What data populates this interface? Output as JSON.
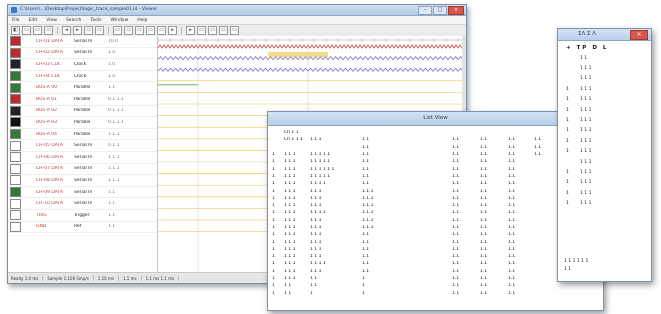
{
  "main": {
    "title": "C:\\Users\\...\\Desktop\\Project\\logic_trace_sample01.ld - Viewer",
    "window_buttons": [
      "–",
      "□",
      "×"
    ],
    "menu": [
      "File",
      "Edit",
      "View",
      "Search",
      "Tools",
      "Window",
      "Help"
    ],
    "toolbar": [
      "◧",
      "▭",
      "▭",
      "▭",
      "◂",
      "▸",
      "▭",
      "▭",
      "▭",
      "▭",
      "▭",
      "▭",
      "▭",
      "▸",
      "▸",
      "▭",
      "▭",
      "▭",
      "▭"
    ],
    "signals": [
      {
        "num": "",
        "name": "CH-01 DATA",
        "type": "Serial In",
        "val": "10.0",
        "color": "#c62828"
      },
      {
        "num": "",
        "name": "CH-02 DATA",
        "type": "Serial In",
        "val": "1.0",
        "color": "#c62828"
      },
      {
        "num": "",
        "name": "CH-03 CLK",
        "type": "Clock",
        "val": "1.0",
        "color": "#222222"
      },
      {
        "num": "",
        "name": "CH-04 CLK",
        "type": "Clock",
        "val": "1.0",
        "color": "#2e7d32"
      },
      {
        "num": "",
        "name": "BUS-A 00",
        "type": "Parallel",
        "val": "1.1",
        "color": "#2e7d32"
      },
      {
        "num": "",
        "name": "BUS-A 01",
        "type": "Parallel",
        "val": "0.1.1.1",
        "color": "#c62828"
      },
      {
        "num": "",
        "name": "BUS-A 02",
        "type": "Parallel",
        "val": "0.1.1.1",
        "color": "#222222"
      },
      {
        "num": "",
        "name": "BUS-A 03",
        "type": "Parallel",
        "val": "0.1.1.1",
        "color": "#111111"
      },
      {
        "num": "",
        "name": "BUS-A 04",
        "type": "Parallel",
        "val": "1.1.1",
        "color": "#2e7d32"
      },
      {
        "num": "",
        "name": "CH-05 DATA",
        "type": "Serial In",
        "val": "0.1.1",
        "color": "#ffffff"
      },
      {
        "num": "",
        "name": "CH-06 DATA",
        "type": "Serial In",
        "val": "1.1.1",
        "color": "#ffffff"
      },
      {
        "num": "",
        "name": "CH-07 DATA",
        "type": "Serial In",
        "val": "1.1.1",
        "color": "#ffffff"
      },
      {
        "num": "",
        "name": "CH-08 DATA",
        "type": "Serial In",
        "val": "1.1.1",
        "color": "#ffffff"
      },
      {
        "num": "",
        "name": "CH-09 DATA",
        "type": "Serial In",
        "val": "1.1",
        "color": "#2e7d32"
      },
      {
        "num": "",
        "name": "CH-10 DATA",
        "type": "Serial In",
        "val": "1.1",
        "color": "#ffffff"
      },
      {
        "num": "",
        "name": "TRIG",
        "type": "Trigger",
        "val": "1.1",
        "color": "#ffffff"
      },
      {
        "num": "",
        "name": "GND",
        "type": "Ref",
        "val": "1.1",
        "color": "#ffffff"
      }
    ],
    "status": [
      "Ready 1.0 ms",
      "Sample 1:100 Smp/s",
      "1.10 ms",
      "1.1 ms",
      "1.1 ms 1.1 ms"
    ]
  },
  "list": {
    "title": "List View",
    "rows": [
      [
        "",
        "Ch 1 1",
        "",
        "",
        "",
        "",
        "",
        "",
        ""
      ],
      [
        "",
        "Ch 1 1 1",
        "1 1 1",
        "1 1",
        "",
        "1.1",
        "1.1",
        "1.1",
        "1.1"
      ],
      [
        "",
        "",
        "",
        "1.1",
        "",
        "1.1",
        "1.1",
        "1.1",
        "1.1"
      ],
      [
        "1",
        "1 1 1",
        "1 1 1 1 1",
        "1.1",
        "",
        "1.1",
        "1.1",
        "1.1",
        "1.1"
      ],
      [
        "1",
        "1 1 1",
        "1 1 1 1 1",
        "1.1",
        "",
        "1.1",
        "1.1",
        "1.1",
        ""
      ],
      [
        "1",
        "1 1 1",
        "1 1 1 1 1 1",
        "1.1",
        "",
        "1.1",
        "1.1",
        "1.1",
        ""
      ],
      [
        "1",
        "1 1 1",
        "1 1 1 1 1",
        "1.1",
        "",
        "1.1",
        "1.1",
        "1.1",
        ""
      ],
      [
        "1",
        "1 1 1",
        "1 1 1 1",
        "1.1",
        "",
        "1.1",
        "1.1",
        "1.1",
        ""
      ],
      [
        "1",
        "1 1 1",
        "1 1 1",
        "1.1.1",
        "",
        "1.1",
        "1.1",
        "1.1",
        ""
      ],
      [
        "1",
        "1 1 1",
        "1 1 1",
        "1.1.1",
        "",
        "1.1",
        "1.1",
        "1.1",
        ""
      ],
      [
        "1",
        "1 1 1",
        "1 1 1",
        "1.1.1",
        "",
        "1.1",
        "1.1",
        "1.1",
        ""
      ],
      [
        "1",
        "1 1 1",
        "1 1 1 1",
        "1.1.1",
        "",
        "1.1",
        "1.1",
        "1.1",
        ""
      ],
      [
        "1",
        "1 1 1",
        "1 1 1",
        "1.1.1",
        "",
        "1.1",
        "1.1",
        "1.1",
        ""
      ],
      [
        "1",
        "1 1 1",
        "1 1 1",
        "1.1.1",
        "",
        "1.1",
        "1.1",
        "1.1",
        ""
      ],
      [
        "1",
        "1 1 1",
        "1 1 1",
        "1.1",
        "",
        "1.1",
        "1.1",
        "1.1",
        ""
      ],
      [
        "1",
        "1 1 1",
        "1 1 1",
        "1.1",
        "",
        "1.1",
        "1.1",
        "1.1",
        ""
      ],
      [
        "1",
        "1 1 1",
        "1 1 1",
        "1.1",
        "",
        "1.1",
        "1.1",
        "1.1",
        ""
      ],
      [
        "1",
        "1 1 1",
        "1 1 1",
        "1.1",
        "",
        "1.1",
        "1.1",
        "1.1",
        ""
      ],
      [
        "1",
        "1 1 1",
        "1 1 1 1",
        "1.1",
        "",
        "1.1",
        "1.1",
        "1.1",
        ""
      ],
      [
        "1",
        "1 1 1",
        "1 1 1",
        "1.1",
        "",
        "1.1",
        "1.1",
        "1.1",
        ""
      ],
      [
        "1",
        "1 1 1",
        "1 1",
        "1",
        "",
        "1.1",
        "1.1",
        "1.1",
        ""
      ],
      [
        "1",
        "1 1",
        "1 1",
        "1",
        "",
        "1.1",
        "1.1",
        "1.1",
        ""
      ],
      [
        "1",
        "1 1",
        "1",
        "1",
        "",
        "1.1",
        "1.1",
        "1.1",
        ""
      ]
    ]
  },
  "side": {
    "title": "ΣΛ Σ Λ",
    "close": "×",
    "header": [
      "+",
      "T P",
      "D",
      "L"
    ],
    "rows": [
      {
        "k": "",
        "v": "1 1"
      },
      {
        "k": "",
        "v": "1 1 1"
      },
      {
        "k": "",
        "v": "1 1 1"
      },
      {
        "k": "1",
        "v": "1 1 1"
      },
      {
        "k": "1",
        "v": "1 1 1"
      },
      {
        "k": "1",
        "v": "1 1 1"
      },
      {
        "k": "1",
        "v": "1 1 1"
      },
      {
        "k": "1",
        "v": "1 1 1"
      },
      {
        "k": "1",
        "v": "1 1 1"
      },
      {
        "k": "1",
        "v": "1 1 1"
      },
      {
        "k": "",
        "v": "1 1 1"
      },
      {
        "k": "1",
        "v": "1 1 1"
      },
      {
        "k": "1",
        "v": "1 1 1"
      },
      {
        "k": "1",
        "v": "1 1 1"
      },
      {
        "k": "1",
        "v": "1 1 1"
      }
    ],
    "footer": [
      "1 1 1 1 1 1",
      "1 1"
    ]
  },
  "colors": {
    "wave_red": "#d24a3a",
    "wave_purple": "#8a6fc4",
    "wave_yellow": "#e6c83c",
    "wave_green": "#4caf50"
  }
}
